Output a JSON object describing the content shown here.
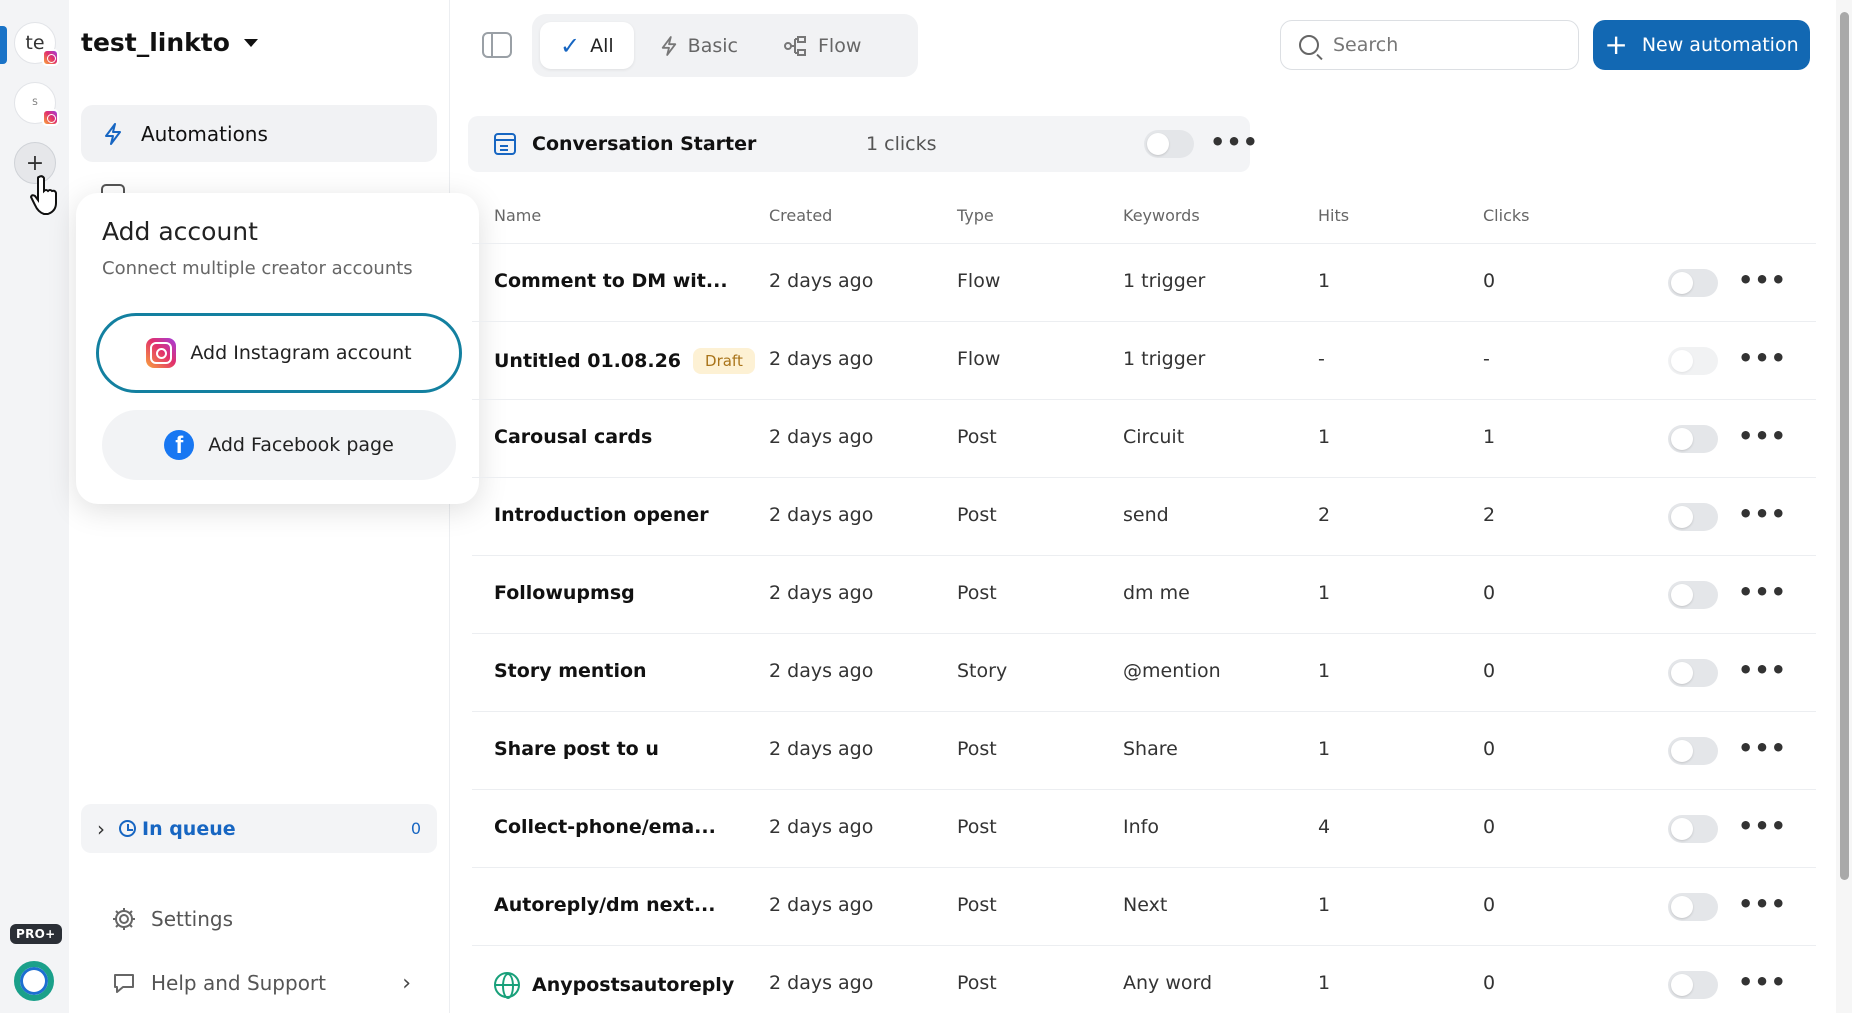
{
  "rail": {
    "accounts": [
      {
        "initials": "te"
      },
      {
        "initials": "S"
      }
    ],
    "pro_badge": "PRO+"
  },
  "sidebar": {
    "workspace_name": "test_linkto",
    "nav": {
      "automations": "Automations"
    },
    "queue": {
      "label": "In queue",
      "count": "0"
    },
    "settings": "Settings",
    "help": "Help and Support"
  },
  "popover": {
    "title": "Add account",
    "subtitle": "Connect multiple creator accounts",
    "instagram_label": "Add Instagram account",
    "facebook_label": "Add Facebook page"
  },
  "filters": {
    "all": "All",
    "basic": "Basic",
    "flow": "Flow"
  },
  "search": {
    "placeholder": "Search"
  },
  "new_automation": "New automation",
  "conversation_starter": {
    "title": "Conversation Starter",
    "clicks": "1 clicks"
  },
  "table": {
    "headers": {
      "name": "Name",
      "created": "Created",
      "type": "Type",
      "keywords": "Keywords",
      "hits": "Hits",
      "clicks": "Clicks"
    },
    "rows": [
      {
        "name": "Comment to DM wit...",
        "badge": "",
        "created": "2 days ago",
        "type": "Flow",
        "keywords": "1 trigger",
        "hits": "1",
        "clicks": "0"
      },
      {
        "name": "Untitled 01.08.26",
        "badge": "Draft",
        "created": "2 days ago",
        "type": "Flow",
        "keywords": "1 trigger",
        "hits": "-",
        "clicks": "-"
      },
      {
        "name": "Carousal cards",
        "badge": "",
        "created": "2 days ago",
        "type": "Post",
        "keywords": "Circuit",
        "hits": "1",
        "clicks": "1"
      },
      {
        "name": "Introduction opener",
        "badge": "",
        "created": "2 days ago",
        "type": "Post",
        "keywords": "send",
        "hits": "2",
        "clicks": "2"
      },
      {
        "name": "Followupmsg",
        "badge": "",
        "created": "2 days ago",
        "type": "Post",
        "keywords": "dm me",
        "hits": "1",
        "clicks": "0"
      },
      {
        "name": "Story mention",
        "badge": "",
        "created": "2 days ago",
        "type": "Story",
        "keywords": "@mention",
        "hits": "1",
        "clicks": "0"
      },
      {
        "name": "Share post to u",
        "badge": "",
        "created": "2 days ago",
        "type": "Post",
        "keywords": "Share",
        "hits": "1",
        "clicks": "0"
      },
      {
        "name": "Collect-phone/ema...",
        "badge": "",
        "created": "2 days ago",
        "type": "Post",
        "keywords": "Info",
        "hits": "4",
        "clicks": "0"
      },
      {
        "name": "Autoreply/dm next...",
        "badge": "",
        "created": "2 days ago",
        "type": "Post",
        "keywords": "Next",
        "hits": "1",
        "clicks": "0"
      },
      {
        "name": "Anypostsautoreply",
        "badge": "",
        "created": "2 days ago",
        "type": "Post",
        "keywords": "Any word",
        "hits": "1",
        "clicks": "0"
      }
    ]
  },
  "colors": {
    "primary": "#1268b3",
    "accent_blue": "#1766c2",
    "draft_bg": "#fdf1d4",
    "draft_text": "#a9741a"
  }
}
